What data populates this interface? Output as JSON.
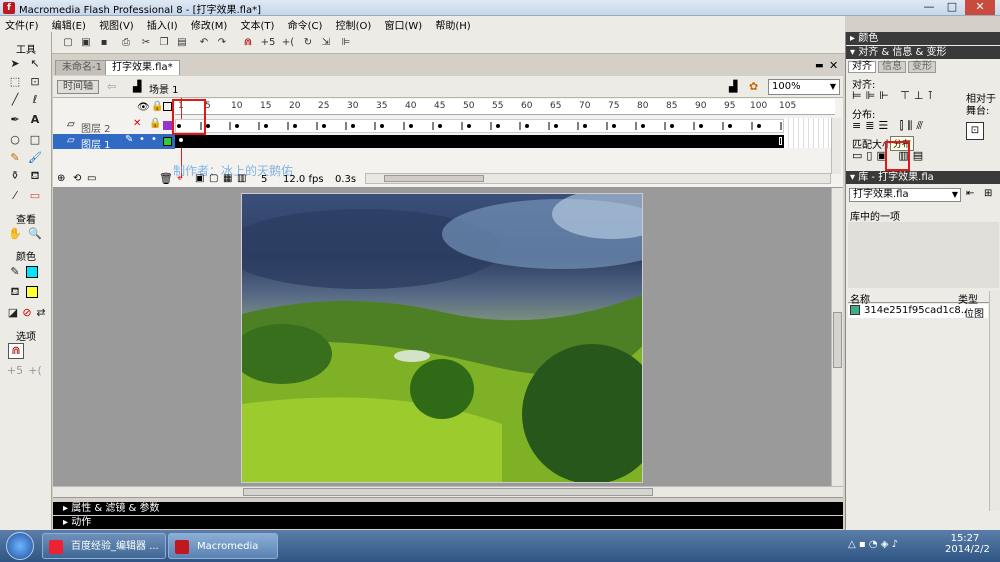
{
  "window": {
    "title": "Macromedia Flash Professional 8 - [打字效果.fla*]",
    "app_icon": "flash-icon",
    "controls": [
      "—",
      "□",
      "✕"
    ]
  },
  "menu": [
    "文件(F)",
    "编辑(E)",
    "视图(V)",
    "插入(I)",
    "修改(M)",
    "文本(T)",
    "命令(C)",
    "控制(O)",
    "窗口(W)",
    "帮助(H)"
  ],
  "tools_panel": {
    "header_tools": "工具",
    "header_view": "查看",
    "header_colors": "颜色",
    "header_options": "选项",
    "stroke_color": "#00e5ff",
    "fill_color": "#ffff33"
  },
  "doc_tabs": [
    "未命名-1",
    "打字效果.fla*"
  ],
  "scene": {
    "timeline_btn": "时间轴",
    "scene_label": "场景 1",
    "zoom": "100%"
  },
  "timeline": {
    "ruler": [
      "1",
      "5",
      "10",
      "15",
      "20",
      "25",
      "30",
      "35",
      "40",
      "45",
      "50",
      "55",
      "60",
      "65",
      "70",
      "75",
      "80",
      "85",
      "90",
      "95",
      "100",
      "105"
    ],
    "layers": [
      {
        "name": "图层 2",
        "color": "#9933cc"
      },
      {
        "name": "图层 1",
        "color": "#33cc33"
      }
    ],
    "status": {
      "frame": "5",
      "fps": "12.0 fps",
      "time": "0.3s"
    },
    "watermark": "制作者：冰上的天鹅佑"
  },
  "bottom_panels": [
    "属性 & 滤镜 & 参数",
    "动作"
  ],
  "right_panels": {
    "color_header": "颜色",
    "align_header": "对齐 & 信息 & 变形",
    "align_tabs": [
      "对齐",
      "信息",
      "变形"
    ],
    "align_label": "对齐:",
    "distribute_label": "分布:",
    "match_label": "匹配大小",
    "spacing_label": "间隔",
    "tooltip": "分布",
    "relative_label": "相对于舞台:",
    "library_header": "库 - 打字效果.fla",
    "library_dropdown": "打字效果.fla",
    "library_count": "库中的一项",
    "col_name": "名称",
    "col_type": "类型",
    "item_name": "314e251f95cad1c8...",
    "item_type": "位图"
  },
  "taskbar": {
    "tasks": [
      "百度经验_编辑器 ...",
      "Macromedia Fla..."
    ],
    "time": "15:27",
    "date": "2014/2/2"
  }
}
